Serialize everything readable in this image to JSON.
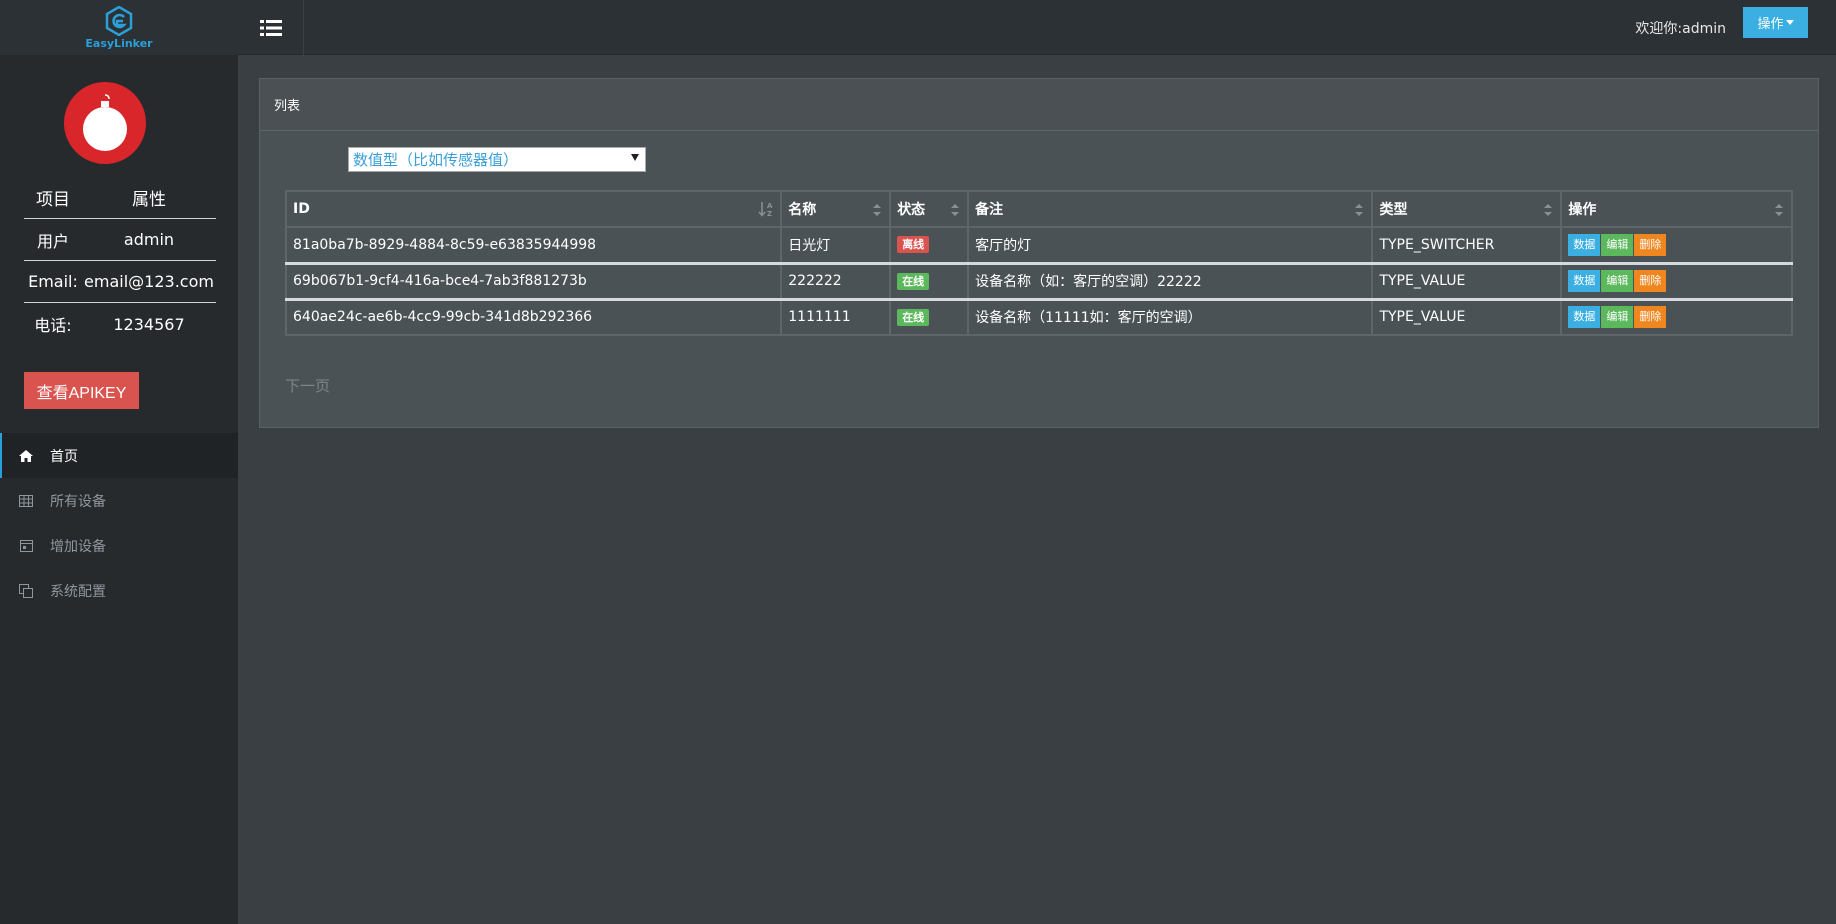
{
  "brand": {
    "name": "EasyLinker"
  },
  "header": {
    "welcome": "欢迎你:admin",
    "ops_label": "操作"
  },
  "profile": {
    "head": {
      "k": "项目",
      "v": "属性"
    },
    "rows": [
      {
        "k": "用户",
        "v": "admin"
      },
      {
        "k": "Email:",
        "v": "email@123.com"
      },
      {
        "k": "电话:",
        "v": "1234567"
      }
    ],
    "apikey_label": "查看APIKEY"
  },
  "nav": {
    "items": [
      {
        "label": "首页",
        "icon": "home-icon",
        "active": true
      },
      {
        "label": "所有设备",
        "icon": "table-icon",
        "active": false
      },
      {
        "label": "增加设备",
        "icon": "calendar-icon",
        "active": false
      },
      {
        "label": "系统配置",
        "icon": "copy-icon",
        "active": false
      }
    ]
  },
  "panel": {
    "title": "列表",
    "select_value": "数值型（比如传感器值）",
    "next_page": "下一页"
  },
  "table": {
    "columns": [
      "ID",
      "名称",
      "状态",
      "备注",
      "类型",
      "操作"
    ],
    "rows": [
      {
        "id": "81a0ba7b-8929-4884-8c59-e63835944998",
        "name": "日光灯",
        "status": "离线",
        "status_kind": "off",
        "note": "客厅的灯",
        "type": "TYPE_SWITCHER"
      },
      {
        "id": "69b067b1-9cf4-416a-bce4-7ab3f881273b",
        "name": "222222",
        "status": "在线",
        "status_kind": "on",
        "note": "设备名称（如：客厅的空调）22222",
        "type": "TYPE_VALUE"
      },
      {
        "id": "640ae24c-ae6b-4cc9-99cb-341d8b292366",
        "name": "1111111",
        "status": "在线",
        "status_kind": "on",
        "note": "设备名称（11111如：客厅的空调）",
        "type": "TYPE_VALUE"
      }
    ],
    "actions": {
      "data": "数据",
      "edit": "编辑",
      "delete": "删除"
    }
  },
  "colors": {
    "accent": "#3bafe2",
    "danger": "#d9534f",
    "success": "#5cb85c",
    "warning": "#f0861f",
    "sidebar_bg": "#262a2d",
    "content_bg": "#393f43"
  }
}
